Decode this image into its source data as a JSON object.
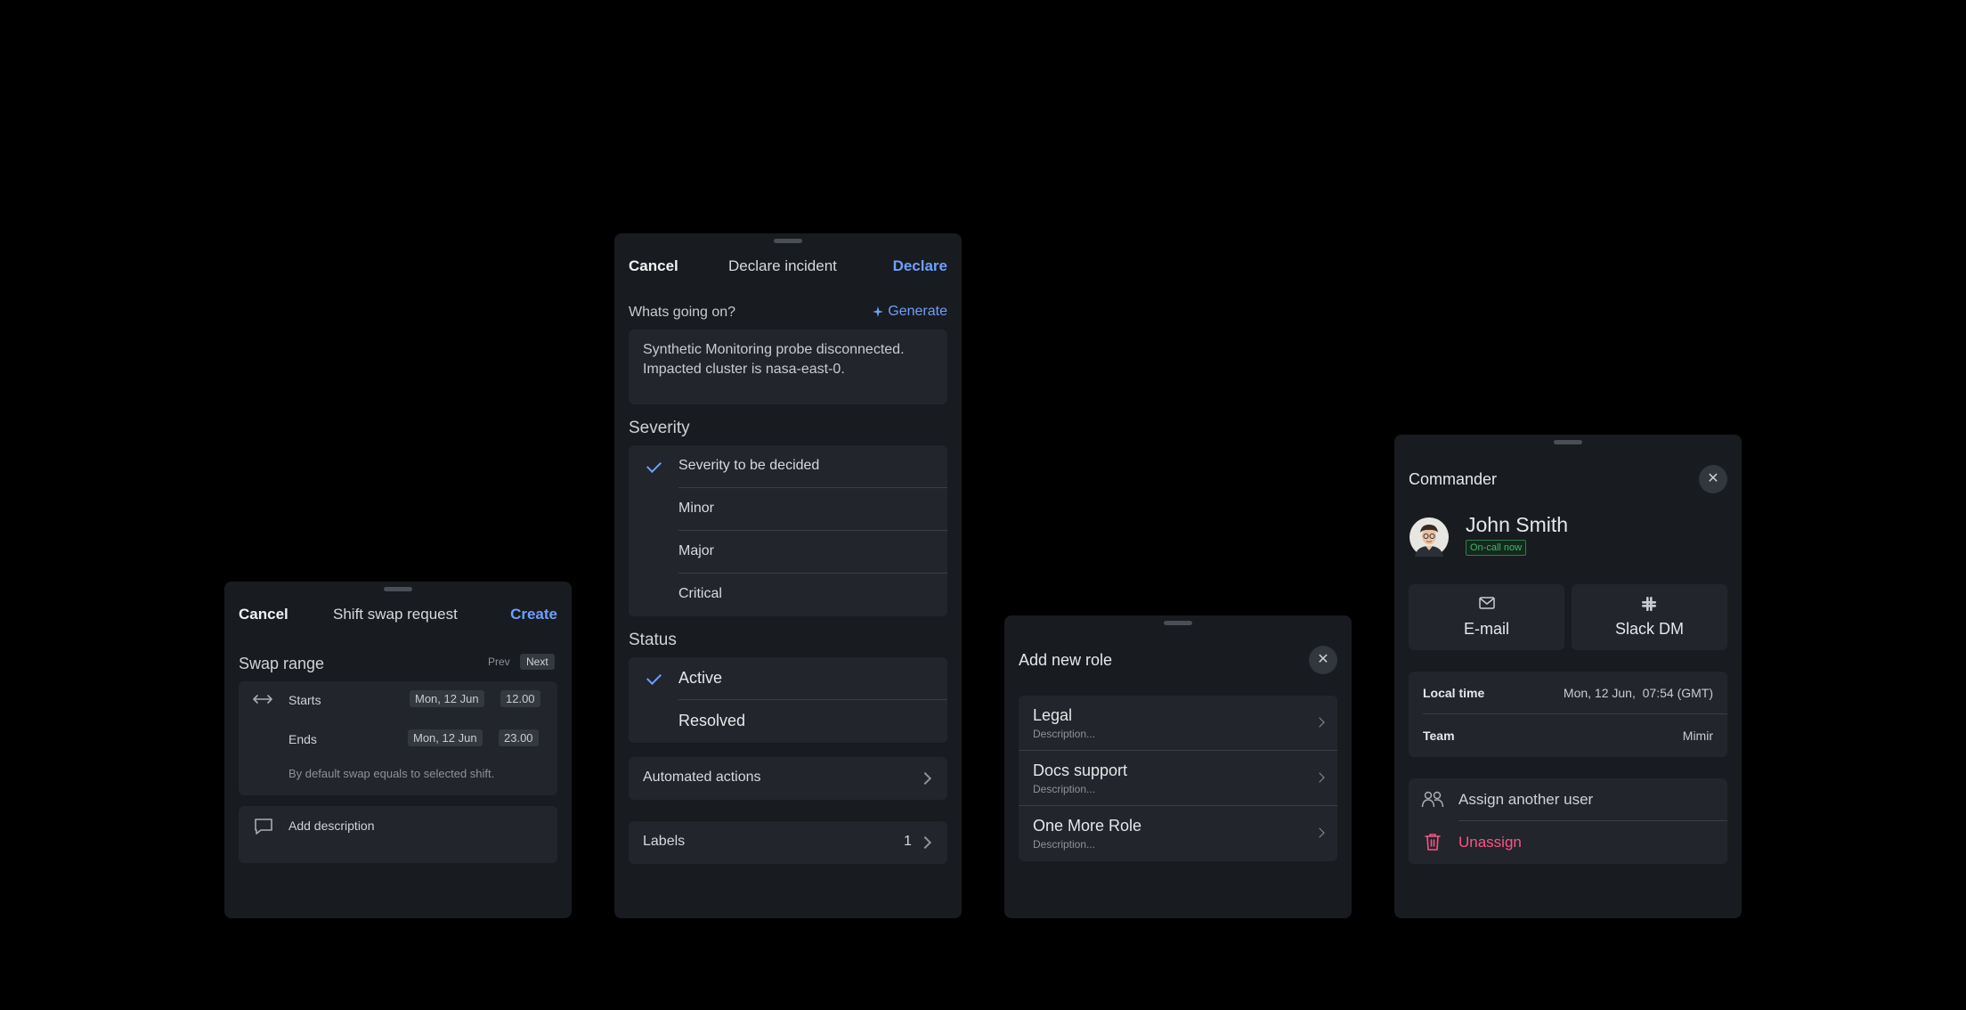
{
  "shift_swap": {
    "cancel_label": "Cancel",
    "title": "Shift swap request",
    "create_label": "Create",
    "swap_range_label": "Swap range",
    "prev_label": "Prev",
    "next_label": "Next",
    "starts_label": "Starts",
    "starts_date": "Mon, 12 Jun",
    "starts_time": "12.00",
    "ends_label": "Ends",
    "ends_date": "Mon, 12 Jun",
    "ends_time": "23.00",
    "hint": "By default swap equals to selected shift.",
    "add_description_label": "Add description"
  },
  "declare_incident": {
    "cancel_label": "Cancel",
    "title": "Declare incident",
    "declare_label": "Declare",
    "prompt_label": "Whats going on?",
    "generate_label": "Generate",
    "description_line1": "Synthetic Monitoring probe disconnected.",
    "description_line2": "Impacted cluster is nasa-east-0.",
    "severity_label": "Severity",
    "severity_options": [
      "Severity to be decided",
      "Minor",
      "Major",
      "Critical"
    ],
    "severity_selected": "Severity to be decided",
    "status_label": "Status",
    "status_options": [
      "Active",
      "Resolved"
    ],
    "status_selected": "Active",
    "automated_actions_label": "Automated actions",
    "labels_label": "Labels",
    "labels_count": "1"
  },
  "add_role": {
    "title": "Add new role",
    "roles": [
      {
        "name": "Legal",
        "description": "Description..."
      },
      {
        "name": "Docs support",
        "description": "Description..."
      },
      {
        "name": "One More Role",
        "description": "Description..."
      }
    ]
  },
  "commander": {
    "title": "Commander",
    "user_name": "John Smith",
    "status_badge": "On-call now",
    "email_label": "E-mail",
    "slack_label": "Slack DM",
    "local_time_label": "Local time",
    "local_time_value": "Mon, 12 Jun,  07:54 (GMT)",
    "team_label": "Team",
    "team_value": "Mimir",
    "assign_label": "Assign another user",
    "unassign_label": "Unassign"
  },
  "colors": {
    "background": "#000000",
    "sheet": "#181b1f",
    "group": "#22252b",
    "accent": "#6e9fff",
    "danger": "#ff5286",
    "success": "#3fb56a"
  },
  "icons": [
    "drag-handle-icon",
    "arrows-horizontal-icon",
    "comment-icon",
    "sparkle-icon",
    "check-icon",
    "chevron-right-icon",
    "close-icon",
    "envelope-icon",
    "slack-icon",
    "users-icon",
    "trash-icon"
  ]
}
